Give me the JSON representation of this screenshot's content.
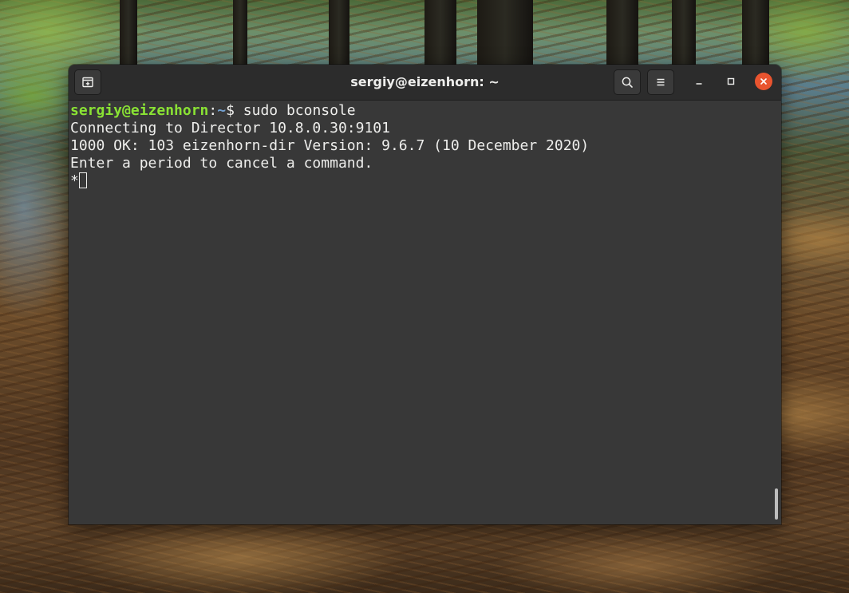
{
  "window": {
    "title": "sergiy@eizenhorn: ~"
  },
  "headerbar": {
    "new_tab_icon": "new-tab-icon",
    "search_icon": "search-icon",
    "menu_icon": "hamburger-menu-icon",
    "minimize_icon": "minimize-icon",
    "maximize_icon": "maximize-icon",
    "close_icon": "close-icon",
    "close_color": "#e9542f"
  },
  "terminal": {
    "prompt": {
      "user_host": "sergiy@eizenhorn",
      "separator": ":",
      "path": "~",
      "symbol": "$ ",
      "command": "sudo bconsole"
    },
    "output": [
      "Connecting to Director 10.8.0.30:9101",
      "1000 OK: 103 eizenhorn-dir Version: 9.6.7 (10 December 2020)",
      "Enter a period to cancel a command."
    ],
    "input_prompt": "*",
    "colors": {
      "background": "#383838",
      "foreground": "#eeeeec",
      "user_host": "#8ae234",
      "path": "#729fcf"
    }
  }
}
